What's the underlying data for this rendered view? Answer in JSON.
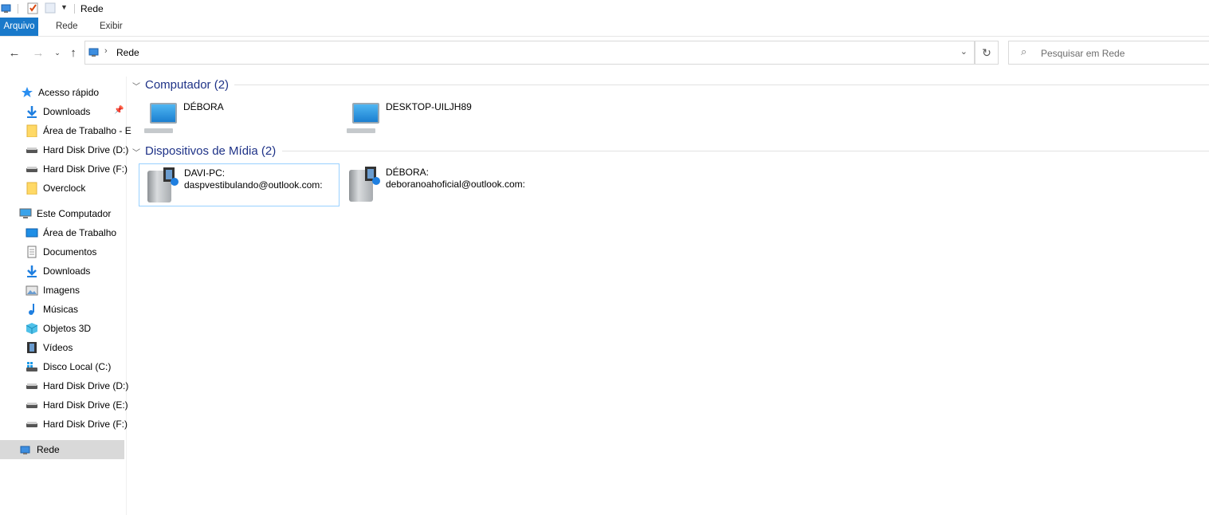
{
  "titlebar": {
    "title": "Rede"
  },
  "ribbon": {
    "tabs": [
      "Arquivo",
      "Rede",
      "Exibir"
    ]
  },
  "address": {
    "crumb": "Rede"
  },
  "search": {
    "placeholder": "Pesquisar em Rede"
  },
  "sidebar": {
    "quick_access": "Acesso rápido",
    "qa_items": [
      "Downloads",
      "Área de Trabalho - E",
      "Hard Disk Drive (D:)",
      "Hard Disk Drive (F:)",
      "Overclock"
    ],
    "this_pc": "Este Computador",
    "pc_items": [
      "Área de Trabalho",
      "Documentos",
      "Downloads",
      "Imagens",
      "Músicas",
      "Objetos 3D",
      "Vídeos",
      "Disco Local (C:)",
      "Hard Disk Drive (D:)",
      "Hard Disk Drive (E:)",
      "Hard Disk Drive (F:)"
    ],
    "network": "Rede"
  },
  "content": {
    "group1": {
      "label": "Computador (2)",
      "items": [
        "DÉBORA",
        "DESKTOP-UILJH89"
      ]
    },
    "group2": {
      "label": "Dispositivos de Mídia (2)",
      "items": [
        {
          "line1": "DAVI-PC:",
          "line2": "daspvestibulando@outlook.com:"
        },
        {
          "line1": "DÉBORA:",
          "line2": "deboranoahoficial@outlook.com:"
        }
      ]
    }
  },
  "colors": {
    "accent": "#1979ca",
    "group_heading": "#1e3287",
    "selection": "#d9d9d9"
  }
}
